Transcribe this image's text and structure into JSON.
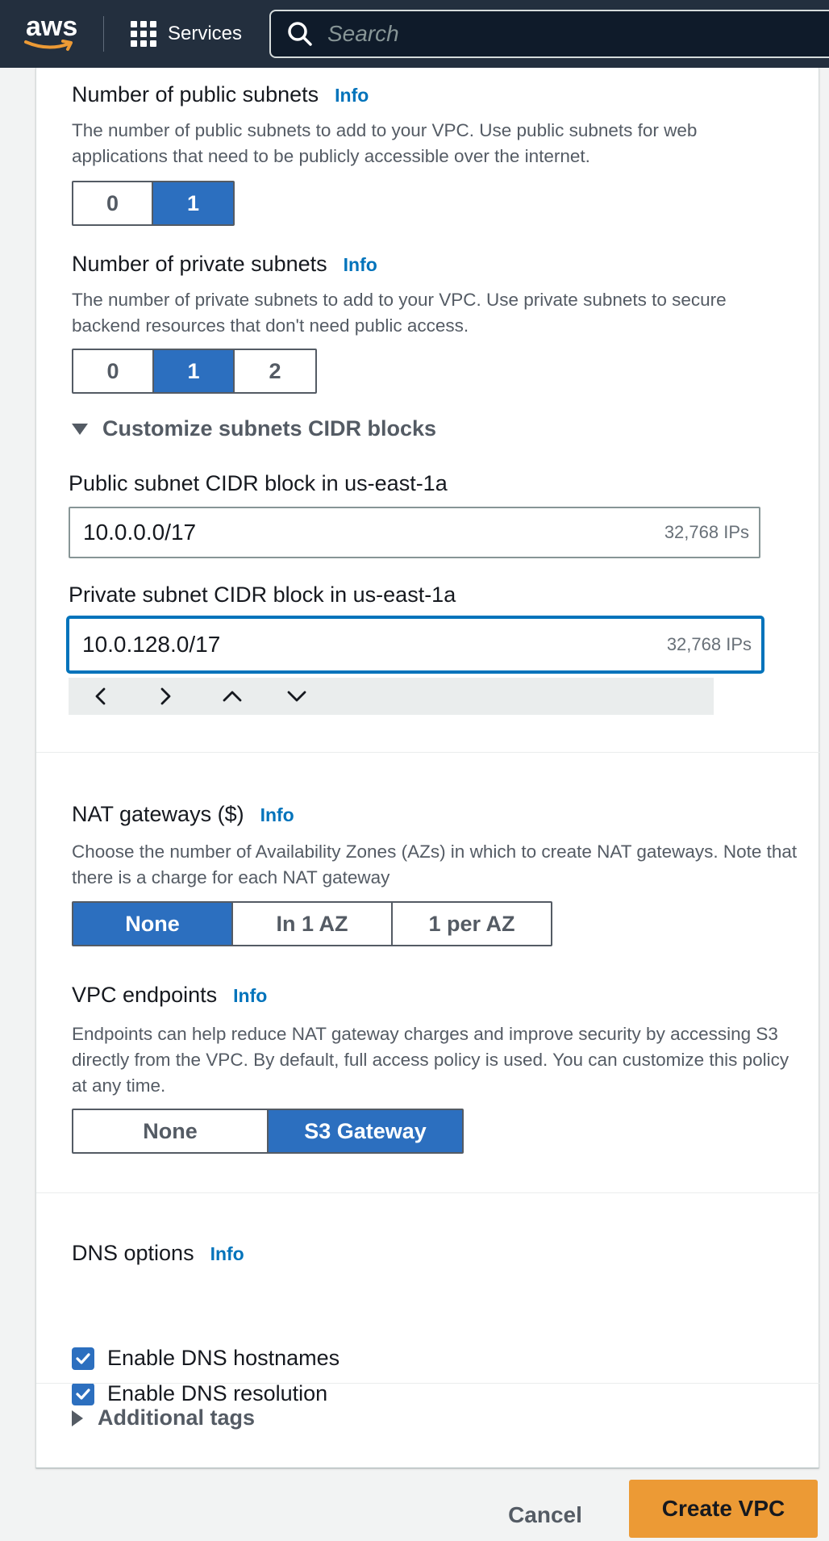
{
  "nav": {
    "logo_text": "aws",
    "services_label": "Services",
    "search_placeholder": "Search"
  },
  "public_subnets": {
    "label": "Number of public subnets",
    "info": "Info",
    "description": "The number of public subnets to add to your VPC. Use public subnets for web applications that need to be publicly accessible over the internet.",
    "options": [
      "0",
      "1"
    ],
    "selected": "1"
  },
  "private_subnets": {
    "label": "Number of private subnets",
    "info": "Info",
    "description": "The number of private subnets to add to your VPC. Use private subnets to secure backend resources that don't need public access.",
    "options": [
      "0",
      "1",
      "2"
    ],
    "selected": "1"
  },
  "customize_cidr": {
    "label": "Customize subnets CIDR blocks",
    "public": {
      "label": "Public subnet CIDR block in us-east-1a",
      "value": "10.0.0.0/17",
      "count": "32,768 IPs"
    },
    "private": {
      "label": "Private subnet CIDR block in us-east-1a",
      "value": "10.0.128.0/17",
      "count": "32,768 IPs"
    }
  },
  "nat_gateways": {
    "label": "NAT gateways ($)",
    "info": "Info",
    "description": "Choose the number of Availability Zones (AZs) in which to create NAT gateways. Note that there is a charge for each NAT gateway",
    "options": [
      "None",
      "In 1 AZ",
      "1 per AZ"
    ],
    "selected": "None"
  },
  "vpc_endpoints": {
    "label": "VPC endpoints",
    "info": "Info",
    "description": "Endpoints can help reduce NAT gateway charges and improve security by accessing S3 directly from the VPC. By default, full access policy is used. You can customize this policy at any time.",
    "options": [
      "None",
      "S3 Gateway"
    ],
    "selected": "S3 Gateway"
  },
  "dns_options": {
    "label": "DNS options",
    "info": "Info",
    "hostnames_label": "Enable DNS hostnames",
    "hostnames_checked": true,
    "resolution_label": "Enable DNS resolution",
    "resolution_checked": true
  },
  "additional_tags": {
    "label": "Additional tags"
  },
  "footer": {
    "cancel_label": "Cancel",
    "create_label": "Create VPC"
  },
  "colors": {
    "nav_bg": "#232f3e",
    "selected_blue": "#2c6fbf",
    "link_blue": "#0073bb",
    "primary_orange": "#ec9a35"
  }
}
